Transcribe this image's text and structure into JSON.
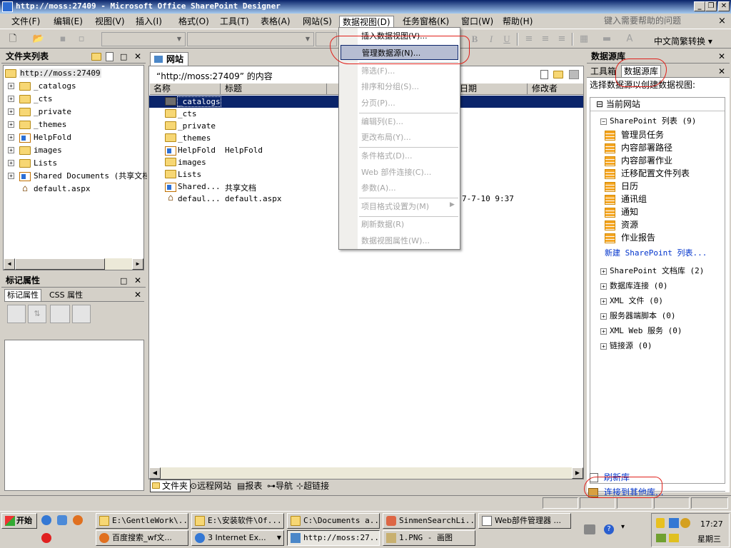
{
  "window": {
    "title": "http://moss:27409 - Microsoft Office SharePoint Designer",
    "buttons": {
      "minimize": "_",
      "restore": "❐",
      "close": "✕"
    }
  },
  "menubar": {
    "items": [
      "文件(F)",
      "编辑(E)",
      "视图(V)",
      "插入(I)",
      "格式(O)",
      "工具(T)",
      "表格(A)",
      "网站(S)",
      "数据视图(D)",
      "任务窗格(K)",
      "窗口(W)",
      "帮助(H)"
    ],
    "help_placeholder": "键入需要帮助的问题",
    "close_glyph": "×"
  },
  "toolbar": {
    "bold": "B",
    "italic": "I",
    "underline": "U",
    "translate_label": "中文简繁转换 ▾"
  },
  "folder_list": {
    "title": "文件夹列表",
    "root": "http://moss:27409",
    "items": [
      "_catalogs",
      "_cts",
      "_private",
      "_themes",
      "HelpFold",
      "images",
      "Lists",
      "Shared Documents (共享文档",
      "default.aspx"
    ]
  },
  "tag_props": {
    "title": "标记属性",
    "tabs": [
      "标记属性",
      "CSS 属性"
    ]
  },
  "center": {
    "tab": "网站",
    "heading": "“http://moss:27409” 的内容",
    "columns": [
      "名称",
      "标题",
      "日期",
      "修改者"
    ],
    "rows": [
      {
        "name": "_catalogs",
        "title": "",
        "date": ""
      },
      {
        "name": "_cts",
        "title": "",
        "date": ""
      },
      {
        "name": "_private",
        "title": "",
        "date": ""
      },
      {
        "name": "_themes",
        "title": "",
        "date": ""
      },
      {
        "name": "HelpFold",
        "title": "HelpFold",
        "date": ""
      },
      {
        "name": "images",
        "title": "",
        "date": ""
      },
      {
        "name": "Lists",
        "title": "",
        "date": ""
      },
      {
        "name": "Shared...",
        "title": "共享文档",
        "date": ""
      },
      {
        "name": "defaul...",
        "title": "default.aspx",
        "date": "7-7-10 9:37"
      }
    ],
    "bottom_tabs": [
      "文件夹",
      "远程网站",
      "报表",
      "导航",
      "超链接"
    ]
  },
  "dropdown": {
    "items": [
      {
        "label": "插入数据视图(V)...",
        "enabled": true
      },
      {
        "label": "管理数据源(N)...",
        "enabled": true,
        "selected": true
      },
      {
        "label": "筛选(F)...",
        "enabled": false
      },
      {
        "label": "排序和分组(S)...",
        "enabled": false
      },
      {
        "label": "分页(P)...",
        "enabled": false
      },
      {
        "label": "编辑列(E)...",
        "enabled": false
      },
      {
        "label": "更改布局(Y)...",
        "enabled": false
      },
      {
        "label": "条件格式(D)...",
        "enabled": false
      },
      {
        "label": "Web 部件连接(C)...",
        "enabled": false
      },
      {
        "label": "参数(A)...",
        "enabled": false
      },
      {
        "label": "项目格式设置为(M)",
        "enabled": false,
        "submenu": true
      },
      {
        "label": "刷新数据(R)",
        "enabled": false
      },
      {
        "label": "数据视图属性(W)...",
        "enabled": false
      }
    ]
  },
  "data_source": {
    "title": "数据源库",
    "tabs": [
      "工具箱",
      "数据源库"
    ],
    "instruction": "选择数据源以创建数据视图:",
    "site": "当前网站",
    "sp_lists": "SharePoint 列表 (9)",
    "list_items": [
      "管理员任务",
      "内容部署路径",
      "内容部署作业",
      "迁移配置文件列表",
      "日历",
      "通讯组",
      "通知",
      "资源",
      "作业报告"
    ],
    "new_link": "新建 SharePoint 列表...",
    "groups": [
      "SharePoint 文档库 (2)",
      "数据库连接 (0)",
      "XML 文件 (0)",
      "服务器端脚本 (0)",
      "XML Web 服务 (0)",
      "链接源 (0)"
    ],
    "refresh": "刷新库",
    "connect": "连接到其他库..."
  },
  "taskbar": {
    "start": "开始",
    "row1": [
      "E:\\GentleWork\\...",
      "E:\\安装软件\\Of...",
      "C:\\Documents a...",
      "SinmenSearchLi...",
      "Web部件管理器 ..."
    ],
    "row2": [
      "百度搜索_wf文...",
      "3 Internet Ex...",
      "http://moss:27...",
      "1.PNG - 画图"
    ],
    "time": "17:27",
    "weekday": "星期三"
  }
}
